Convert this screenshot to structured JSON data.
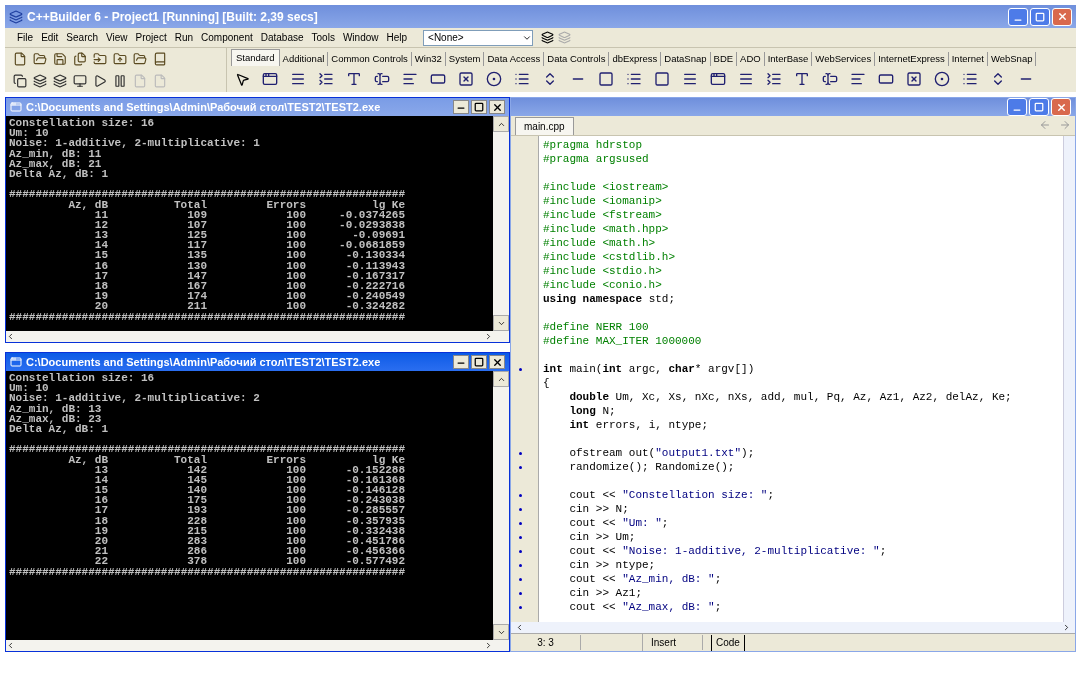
{
  "ide": {
    "title": "C++Builder 6 - Project1 [Running] [Built: 2,39 secs]",
    "menu": [
      "File",
      "Edit",
      "Search",
      "View",
      "Project",
      "Run",
      "Component",
      "Database",
      "Tools",
      "Window",
      "Help"
    ],
    "target_combo": {
      "value": "<None>"
    },
    "palette_tabs": [
      {
        "label": "Standard",
        "selected": true
      },
      {
        "label": "Additional",
        "selected": false
      },
      {
        "label": "Common Controls",
        "selected": false
      },
      {
        "label": "Win32",
        "selected": false
      },
      {
        "label": "System",
        "selected": false
      },
      {
        "label": "Data Access",
        "selected": false
      },
      {
        "label": "Data Controls",
        "selected": false
      },
      {
        "label": "dbExpress",
        "selected": false
      },
      {
        "label": "DataSnap",
        "selected": false
      },
      {
        "label": "BDE",
        "selected": false
      },
      {
        "label": "ADO",
        "selected": false
      },
      {
        "label": "InterBase",
        "selected": false
      },
      {
        "label": "WebServices",
        "selected": false
      },
      {
        "label": "InternetExpress",
        "selected": false
      },
      {
        "label": "Internet",
        "selected": false
      },
      {
        "label": "WebSnap",
        "selected": false
      }
    ]
  },
  "consoles": [
    {
      "title": "C:\\Documents and Settings\\Admin\\Рабочий стол\\TEST2\\TEST2.exe",
      "active": false,
      "prompt_lines": [
        "Constellation size: 16",
        "Um: 10",
        "Noise: 1-additive, 2-multiplicative: 1",
        "Az_min, dB: 11",
        "Az_max, dB: 21",
        "Delta Az, dB: 1"
      ],
      "separator_top": "############################################################",
      "columns": [
        "Az, dB",
        "Total",
        "Errors",
        "lg Ke"
      ],
      "rows": [
        [
          "11",
          "109",
          "100",
          "-0.0374265"
        ],
        [
          "12",
          "107",
          "100",
          "-0.0293838"
        ],
        [
          "13",
          "125",
          "100",
          "-0.09691"
        ],
        [
          "14",
          "117",
          "100",
          "-0.0681859"
        ],
        [
          "15",
          "135",
          "100",
          "-0.130334"
        ],
        [
          "16",
          "130",
          "100",
          "-0.113943"
        ],
        [
          "17",
          "147",
          "100",
          "-0.167317"
        ],
        [
          "18",
          "167",
          "100",
          "-0.222716"
        ],
        [
          "19",
          "174",
          "100",
          "-0.240549"
        ],
        [
          "20",
          "211",
          "100",
          "-0.324282"
        ]
      ],
      "separator_bottom": "############################################################"
    },
    {
      "title": "C:\\Documents and Settings\\Admin\\Рабочий стол\\TEST2\\TEST2.exe",
      "active": true,
      "prompt_lines": [
        "Constellation size: 16",
        "Um: 10",
        "Noise: 1-additive, 2-multiplicative: 2",
        "Az_min, dB: 13",
        "Az_max, dB: 23",
        "Delta Az, dB: 1"
      ],
      "separator_top": "############################################################",
      "columns": [
        "Az, dB",
        "Total",
        "Errors",
        "lg Ke"
      ],
      "rows": [
        [
          "13",
          "142",
          "100",
          "-0.152288"
        ],
        [
          "14",
          "145",
          "100",
          "-0.161368"
        ],
        [
          "15",
          "140",
          "100",
          "-0.146128"
        ],
        [
          "16",
          "175",
          "100",
          "-0.243038"
        ],
        [
          "17",
          "193",
          "100",
          "-0.285557"
        ],
        [
          "18",
          "228",
          "100",
          "-0.357935"
        ],
        [
          "19",
          "215",
          "100",
          "-0.332438"
        ],
        [
          "20",
          "283",
          "100",
          "-0.451786"
        ],
        [
          "21",
          "286",
          "100",
          "-0.456366"
        ],
        [
          "22",
          "378",
          "100",
          "-0.577492"
        ]
      ],
      "separator_bottom": "############################################################"
    }
  ],
  "editor": {
    "tabs": [
      {
        "label": "main.cpp",
        "selected": true
      }
    ],
    "lines": [
      {
        "dot": false,
        "segments": [
          {
            "kind": "directive",
            "text": "#pragma hdrstop"
          }
        ]
      },
      {
        "dot": false,
        "segments": [
          {
            "kind": "directive",
            "text": "#pragma argsused"
          }
        ]
      },
      {
        "blank": true
      },
      {
        "dot": false,
        "segments": [
          {
            "kind": "directive",
            "text": "#include <iostream>"
          }
        ]
      },
      {
        "dot": false,
        "segments": [
          {
            "kind": "directive",
            "text": "#include <iomanip>"
          }
        ]
      },
      {
        "dot": false,
        "segments": [
          {
            "kind": "directive",
            "text": "#include <fstream>"
          }
        ]
      },
      {
        "dot": false,
        "segments": [
          {
            "kind": "directive",
            "text": "#include <math.hpp>"
          }
        ]
      },
      {
        "dot": false,
        "segments": [
          {
            "kind": "directive",
            "text": "#include <math.h>"
          }
        ]
      },
      {
        "dot": false,
        "segments": [
          {
            "kind": "directive",
            "text": "#include <cstdlib.h>"
          }
        ]
      },
      {
        "dot": false,
        "segments": [
          {
            "kind": "directive",
            "text": "#include <stdio.h>"
          }
        ]
      },
      {
        "dot": false,
        "segments": [
          {
            "kind": "directive",
            "text": "#include <conio.h>"
          }
        ]
      },
      {
        "dot": false,
        "segments": [
          {
            "kind": "keyword",
            "text": "using namespace"
          },
          {
            "kind": "plain",
            "text": " std;"
          }
        ]
      },
      {
        "blank": true
      },
      {
        "dot": false,
        "segments": [
          {
            "kind": "directive",
            "text": "#define NERR 100"
          }
        ]
      },
      {
        "dot": false,
        "segments": [
          {
            "kind": "directive",
            "text": "#define MAX_ITER 1000000"
          }
        ]
      },
      {
        "blank": true
      },
      {
        "dot": true,
        "segments": [
          {
            "kind": "keyword",
            "text": "int"
          },
          {
            "kind": "plain",
            "text": " main("
          },
          {
            "kind": "keyword",
            "text": "int"
          },
          {
            "kind": "plain",
            "text": " argc, "
          },
          {
            "kind": "keyword",
            "text": "char"
          },
          {
            "kind": "plain",
            "text": "* argv[])"
          }
        ]
      },
      {
        "dot": false,
        "segments": [
          {
            "kind": "plain",
            "text": "{"
          }
        ]
      },
      {
        "dot": false,
        "segments": [
          {
            "kind": "keyword",
            "text": "    double"
          },
          {
            "kind": "plain",
            "text": " Um, Xc, Xs, nXc, nXs, add, mul, Pq, Az, Az1, Az2, delAz, Ke;"
          }
        ]
      },
      {
        "dot": false,
        "segments": [
          {
            "kind": "keyword",
            "text": "    long"
          },
          {
            "kind": "plain",
            "text": " N;"
          }
        ]
      },
      {
        "dot": false,
        "segments": [
          {
            "kind": "keyword",
            "text": "    int"
          },
          {
            "kind": "plain",
            "text": " errors, i, ntype;"
          }
        ]
      },
      {
        "blank": true
      },
      {
        "dot": true,
        "segments": [
          {
            "kind": "plain",
            "text": "    ofstream out("
          },
          {
            "kind": "string",
            "text": "\"output1.txt\""
          },
          {
            "kind": "plain",
            "text": ");"
          }
        ]
      },
      {
        "dot": true,
        "segments": [
          {
            "kind": "plain",
            "text": "    randomize(); Randomize();"
          }
        ]
      },
      {
        "blank": true
      },
      {
        "dot": true,
        "segments": [
          {
            "kind": "plain",
            "text": "    cout << "
          },
          {
            "kind": "string",
            "text": "\"Constellation size: \""
          },
          {
            "kind": "plain",
            "text": ";"
          }
        ]
      },
      {
        "dot": true,
        "segments": [
          {
            "kind": "plain",
            "text": "    cin >> N;"
          }
        ]
      },
      {
        "dot": true,
        "segments": [
          {
            "kind": "plain",
            "text": "    cout << "
          },
          {
            "kind": "string",
            "text": "\"Um: \""
          },
          {
            "kind": "plain",
            "text": ";"
          }
        ]
      },
      {
        "dot": true,
        "segments": [
          {
            "kind": "plain",
            "text": "    cin >> Um;"
          }
        ]
      },
      {
        "dot": true,
        "segments": [
          {
            "kind": "plain",
            "text": "    cout << "
          },
          {
            "kind": "string",
            "text": "\"Noise: 1-additive, 2-multiplicative: \""
          },
          {
            "kind": "plain",
            "text": ";"
          }
        ]
      },
      {
        "dot": true,
        "segments": [
          {
            "kind": "plain",
            "text": "    cin >> ntype;"
          }
        ]
      },
      {
        "dot": true,
        "segments": [
          {
            "kind": "plain",
            "text": "    cout << "
          },
          {
            "kind": "string",
            "text": "\"Az_min, dB: \""
          },
          {
            "kind": "plain",
            "text": ";"
          }
        ]
      },
      {
        "dot": true,
        "segments": [
          {
            "kind": "plain",
            "text": "    cin >> Az1;"
          }
        ]
      },
      {
        "dot": true,
        "segments": [
          {
            "kind": "plain",
            "text": "    cout << "
          },
          {
            "kind": "string",
            "text": "\"Az_max, dB: \""
          },
          {
            "kind": "plain",
            "text": ";"
          }
        ]
      }
    ],
    "status": {
      "position": "3: 3",
      "mode": "Insert",
      "view_tab": "Code"
    }
  }
}
